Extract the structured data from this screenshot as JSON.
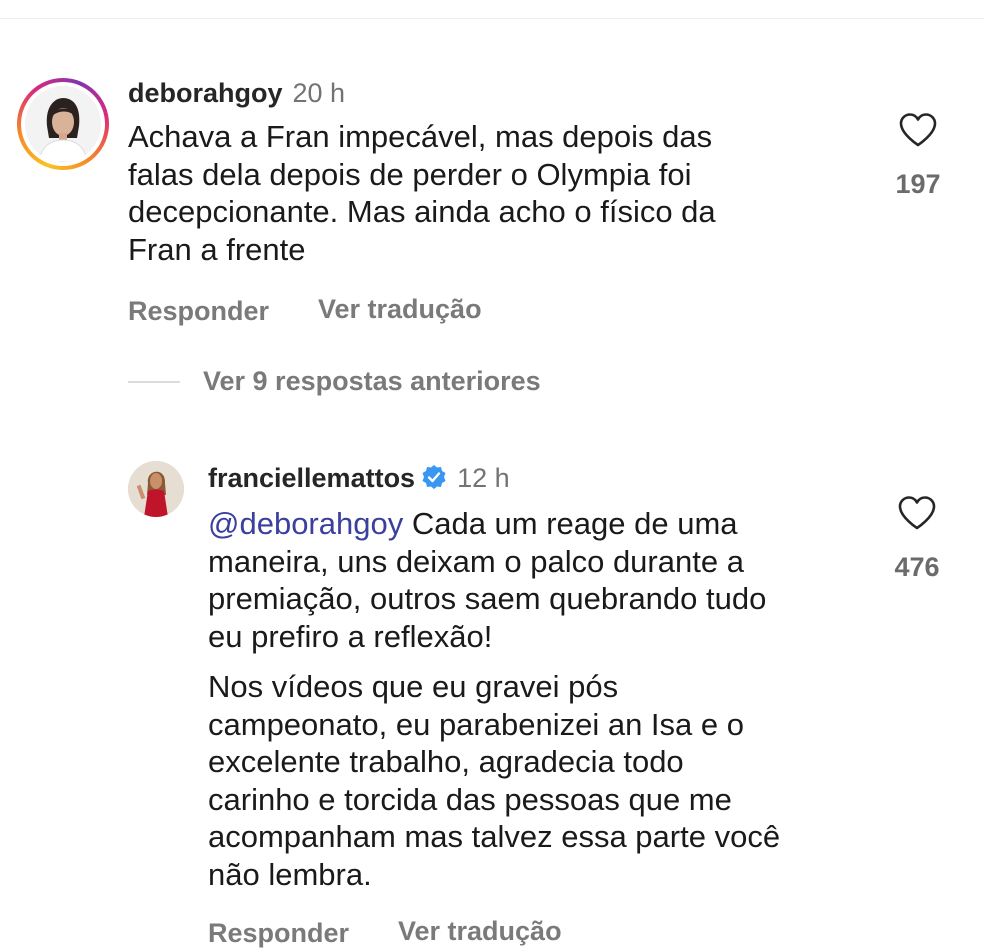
{
  "comments": [
    {
      "username": "deborahgoy",
      "time": "20 h",
      "lines": [
        "Achava a Fran impecável,  mas depois das",
        "falas dela depois de perder o Olympia foi",
        "decepcionante.  Mas ainda acho o físico da",
        "Fran a frente"
      ],
      "likes": "197",
      "reply_label": "Responder",
      "translate_label": "Ver tradução",
      "avatar_icon": "profile-photo-woman"
    }
  ],
  "view_replies_label": "Ver 9 respostas anteriores",
  "reply": {
    "username": "franciellemattos",
    "verified": true,
    "time": "12 h",
    "mention": "@deborahgoy",
    "first_line_rest": " Cada um reage de uma",
    "lines_a": [
      "maneira, uns deixam o palco durante a",
      "premiação, outros saem quebrando tudo",
      "eu prefiro a reflexão!"
    ],
    "lines_b": [
      "Nos vídeos que eu gravei pós",
      "campeonato, eu parabenizei an Isa e o",
      "excelente trabalho, agradecia todo",
      "carinho e torcida das pessoas que me",
      "acompanham mas talvez essa parte você",
      "não lembra."
    ],
    "likes": "476",
    "reply_label": "Responder",
    "translate_label": "Ver tradução"
  },
  "colors": {
    "verified_badge": "#3897f0",
    "mention": "#3b3f9e",
    "secondary_text": "#737373"
  }
}
